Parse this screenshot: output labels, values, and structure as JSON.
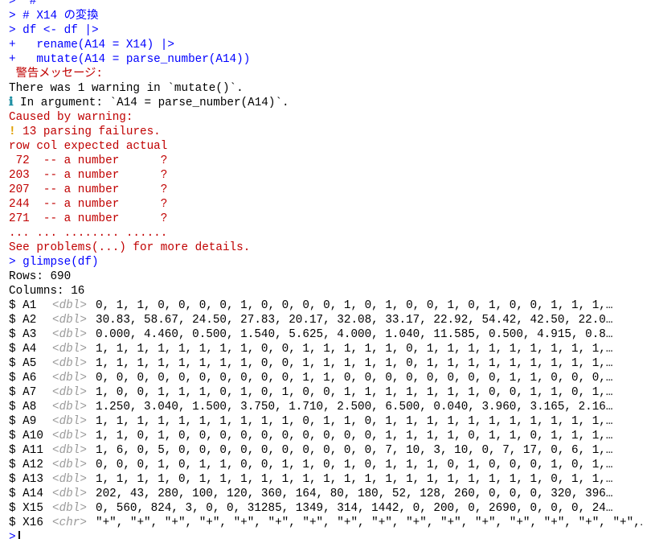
{
  "console": {
    "top_clip": ">  #",
    "code_lines": [
      "> # X14 の変換",
      "> df <- df |>",
      "+   rename(A14 = X14) |>",
      "+   mutate(A14 = parse_number(A14))"
    ],
    "warning_header": " 警告メッセージ:",
    "warning_line1": "There was 1 warning in `mutate()`.",
    "info_icon": "ℹ",
    "warning_line2": " In argument: `A14 = parse_number(A14)`.",
    "caused_by": "Caused by warning:",
    "err_icon": "!",
    "parsing_failures": " 13 parsing failures.",
    "problems_table": [
      "row col expected actual",
      " 72  -- a number      ?",
      "203  -- a number      ?",
      "207  -- a number      ?",
      "244  -- a number      ?",
      "271  -- a number      ?",
      "... ... ........ ......"
    ],
    "see_problems": "See problems(...) for more details.",
    "glimpse_cmd": "> glimpse(df)",
    "rows_line": "Rows: 690",
    "columns_line": "Columns: 16",
    "glimpse": [
      {
        "name": "$ A1 ",
        "type": "<dbl>",
        "values": "0, 1, 1, 0, 0, 0, 0, 1, 0, 0, 0, 0, 1, 0, 1, 0, 0, 1, 0, 1, 0, 0, 1, 1, 1,…"
      },
      {
        "name": "$ A2 ",
        "type": "<dbl>",
        "values": "30.83, 58.67, 24.50, 27.83, 20.17, 32.08, 33.17, 22.92, 54.42, 42.50, 22.0…"
      },
      {
        "name": "$ A3 ",
        "type": "<dbl>",
        "values": "0.000, 4.460, 0.500, 1.540, 5.625, 4.000, 1.040, 11.585, 0.500, 4.915, 0.8…"
      },
      {
        "name": "$ A4 ",
        "type": "<dbl>",
        "values": "1, 1, 1, 1, 1, 1, 1, 1, 0, 0, 1, 1, 1, 1, 1, 0, 1, 1, 1, 1, 1, 1, 1, 1, 1,…"
      },
      {
        "name": "$ A5 ",
        "type": "<dbl>",
        "values": "1, 1, 1, 1, 1, 1, 1, 1, 0, 0, 1, 1, 1, 1, 1, 0, 1, 1, 1, 1, 1, 1, 1, 1, 1,…"
      },
      {
        "name": "$ A6 ",
        "type": "<dbl>",
        "values": "0, 0, 0, 0, 0, 0, 0, 0, 0, 0, 1, 1, 0, 0, 0, 0, 0, 0, 0, 0, 1, 1, 0, 0, 0,…"
      },
      {
        "name": "$ A7 ",
        "type": "<dbl>",
        "values": "1, 0, 0, 1, 1, 1, 0, 1, 0, 1, 0, 0, 1, 1, 1, 1, 1, 1, 1, 0, 0, 1, 1, 0, 1,…"
      },
      {
        "name": "$ A8 ",
        "type": "<dbl>",
        "values": "1.250, 3.040, 1.500, 3.750, 1.710, 2.500, 6.500, 0.040, 3.960, 3.165, 2.16…"
      },
      {
        "name": "$ A9 ",
        "type": "<dbl>",
        "values": "1, 1, 1, 1, 1, 1, 1, 1, 1, 1, 0, 1, 1, 0, 1, 1, 1, 1, 1, 1, 1, 1, 1, 1, 1,…"
      },
      {
        "name": "$ A10",
        "type": "<dbl>",
        "values": "1, 1, 0, 1, 0, 0, 0, 0, 0, 0, 0, 0, 0, 0, 1, 1, 1, 1, 0, 1, 1, 0, 1, 1, 1,…"
      },
      {
        "name": "$ A11",
        "type": "<dbl>",
        "values": "1, 6, 0, 5, 0, 0, 0, 0, 0, 0, 0, 0, 0, 0, 7, 10, 3, 10, 0, 7, 17, 0, 6, 1,…"
      },
      {
        "name": "$ A12",
        "type": "<dbl>",
        "values": "0, 0, 0, 1, 0, 1, 1, 0, 0, 1, 1, 0, 1, 0, 1, 1, 1, 0, 1, 0, 0, 0, 1, 0, 1,…"
      },
      {
        "name": "$ A13",
        "type": "<dbl>",
        "values": "1, 1, 1, 1, 0, 1, 1, 1, 1, 1, 1, 1, 1, 1, 1, 1, 1, 1, 1, 1, 1, 1, 0, 1, 1,…"
      },
      {
        "name": "$ A14",
        "type": "<dbl>",
        "values": "202, 43, 280, 100, 120, 360, 164, 80, 180, 52, 128, 260, 0, 0, 0, 320, 396…"
      },
      {
        "name": "$ X15",
        "type": "<dbl>",
        "values": "0, 560, 824, 3, 0, 0, 31285, 1349, 314, 1442, 0, 200, 0, 2690, 0, 0, 0, 24…"
      },
      {
        "name": "$ X16",
        "type": "<chr>",
        "values": "\"+\", \"+\", \"+\", \"+\", \"+\", \"+\", \"+\", \"+\", \"+\", \"+\", \"+\", \"+\", \"+\", \"+\", \"+\", \"+\",…"
      }
    ],
    "prompt": ">"
  },
  "colors": {
    "code": "#0000ff",
    "output": "#000000",
    "error": "#c00000",
    "type_hint": "#9a9a9a",
    "info_icon": "#1f8fa3",
    "error_icon": "#e0a000"
  }
}
